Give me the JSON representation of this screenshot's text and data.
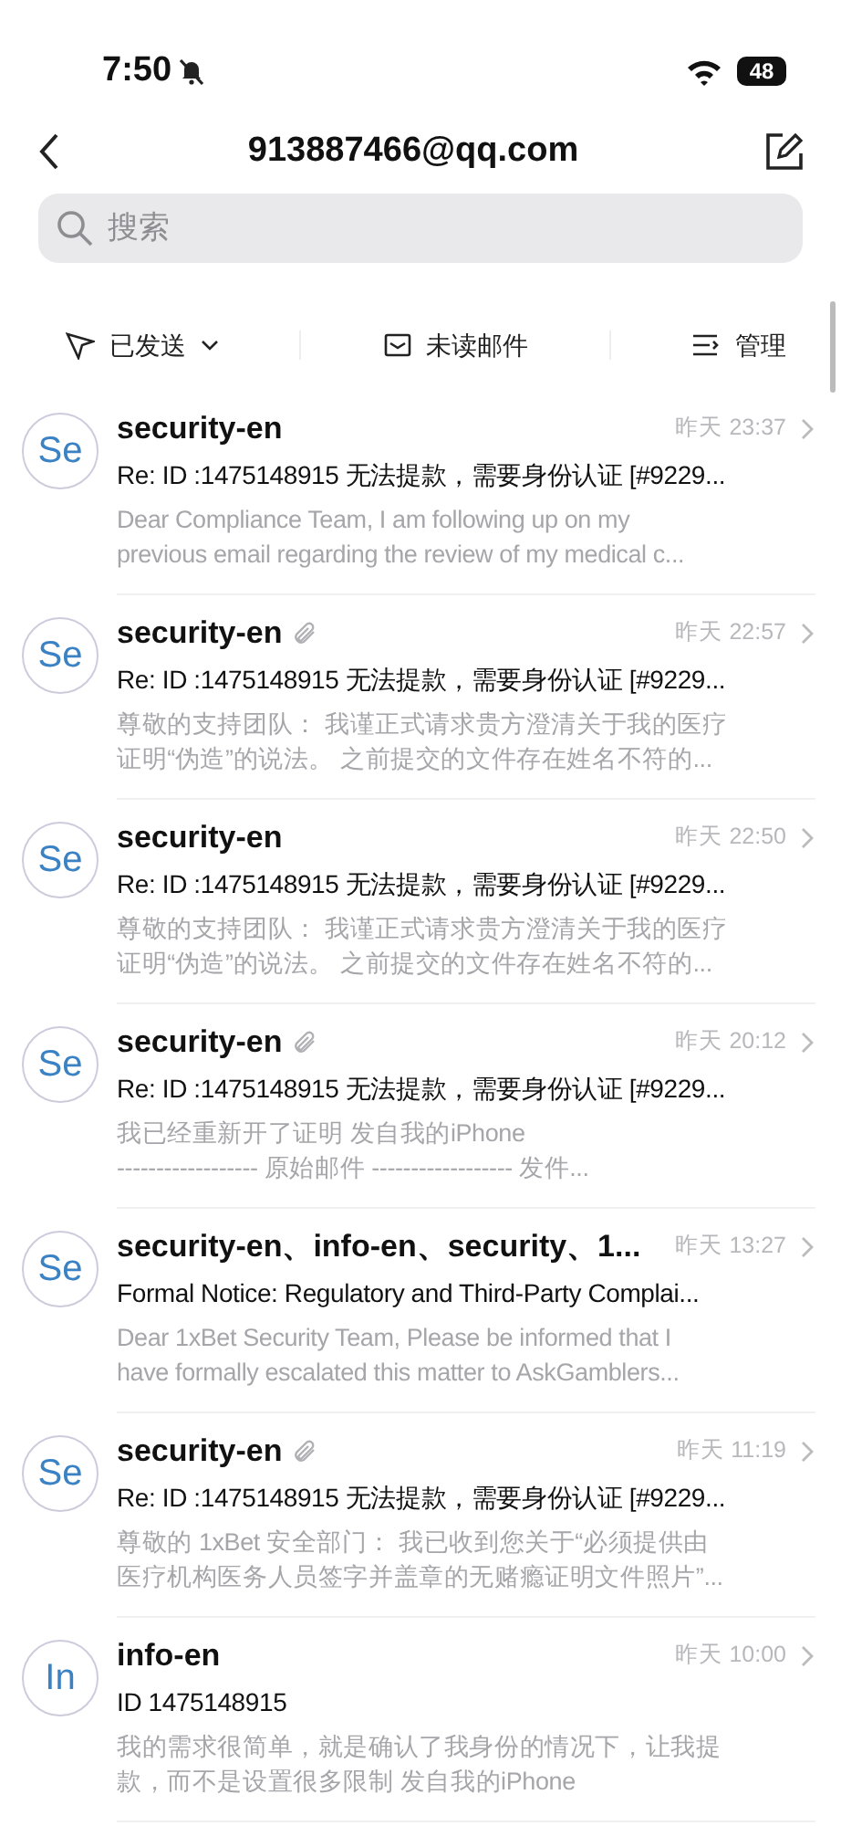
{
  "status_bar": {
    "time": "7:50",
    "muted": true,
    "battery": "48"
  },
  "header": {
    "title": "913887466@qq.com"
  },
  "search": {
    "placeholder": "搜索"
  },
  "toolbar": [
    {
      "kind": "filter",
      "label": "已发送"
    },
    {
      "kind": "unread",
      "label": "未读邮件"
    },
    {
      "kind": "manage",
      "label": "管理"
    }
  ],
  "emails": [
    {
      "avatar": "Se",
      "sender": "security-en",
      "attachment": false,
      "time": "昨天 23:37",
      "subject": "Re: ID :1475148915 无法提款，需要身份认证 [#9229...",
      "preview": [
        "Dear Compliance Team,    I am following up on my",
        "previous email regarding the review of my medical c..."
      ]
    },
    {
      "avatar": "Se",
      "sender": "security-en",
      "attachment": true,
      "time": "昨天 22:57",
      "subject": "Re: ID :1475148915 无法提款，需要身份认证 [#9229...",
      "preview": [
        "尊敬的支持团队：   我谨正式请求贵方澄清关于我的医疗",
        "证明“伪造”的说法。 之前提交的文件存在姓名不符的..."
      ]
    },
    {
      "avatar": "Se",
      "sender": "security-en",
      "attachment": false,
      "time": "昨天 22:50",
      "subject": "Re: ID :1475148915 无法提款，需要身份认证 [#9229...",
      "preview": [
        "尊敬的支持团队：   我谨正式请求贵方澄清关于我的医疗",
        "证明“伪造”的说法。 之前提交的文件存在姓名不符的..."
      ]
    },
    {
      "avatar": "Se",
      "sender": "security-en",
      "attachment": true,
      "time": "昨天 20:12",
      "subject": "Re: ID :1475148915 无法提款，需要身份认证 [#9229...",
      "preview": [
        "我已经重新开了证明  发自我的iPhone",
        "------------------ 原始邮件 ------------------ 发件..."
      ]
    },
    {
      "avatar": "Se",
      "sender": "security-en、info-en、security、1...",
      "attachment": false,
      "time": "昨天 13:27",
      "subject": "Formal Notice: Regulatory and Third-Party Complai...",
      "preview": [
        "Dear 1xBet Security Team,  Please be informed that I",
        "have formally escalated this matter to AskGamblers..."
      ]
    },
    {
      "avatar": "Se",
      "sender": "security-en",
      "attachment": true,
      "time": "昨天 11:19",
      "subject": "Re: ID :1475148915 无法提款，需要身份认证 [#9229...",
      "preview": [
        "尊敬的 1xBet 安全部门：   我已收到您关于“必须提供由",
        "医疗机构医务人员签字并盖章的无赌瘾证明文件照片”..."
      ]
    },
    {
      "avatar": "In",
      "sender": "info-en",
      "attachment": false,
      "time": "昨天 10:00",
      "subject": "ID 1475148915",
      "preview": [
        "我的需求很简单，就是确认了我身份的情况下，让我提",
        "款，而不是设置很多限制 发自我的iPhone"
      ]
    }
  ]
}
